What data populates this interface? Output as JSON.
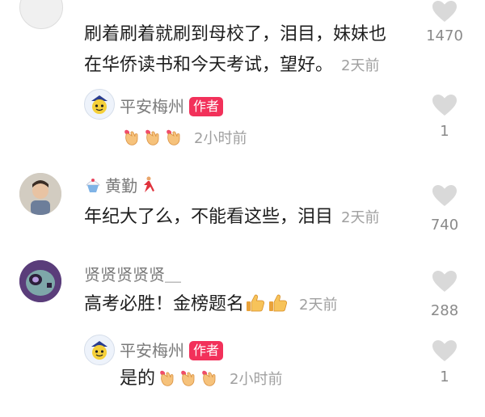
{
  "comments": [
    {
      "username": "",
      "text_line1": "刷着刷着就刷到母校了，泪目，妹妹也",
      "text_line2": "在华侨读书和今天考试，望好。",
      "time": "2天前",
      "likes": "1470"
    },
    {
      "username": "平安梅州",
      "author_tag": "作者",
      "time": "2小时前",
      "likes": "1"
    },
    {
      "username": "黄勤",
      "text": "年纪大了么，不能看这些，泪目",
      "time": "2天前",
      "likes": "740"
    },
    {
      "username": "贤贤贤贤贤＿",
      "text": "高考必胜！金榜题名",
      "time": "2天前",
      "likes": "288"
    },
    {
      "username": "平安梅州",
      "author_tag": "作者",
      "text": "是的",
      "time": "2小时前",
      "likes": "1"
    }
  ],
  "icons": {
    "like": "heart-icon",
    "finger_heart": "finger-heart-emoji",
    "thumbs_up": "thumbs-up-emoji",
    "shaved_ice": "shaved-ice-emoji",
    "dancer": "dancer-emoji"
  },
  "colors": {
    "author_tag": "#f2315a",
    "heart": "#d9d9d9",
    "time": "#a0a0a0",
    "username": "#7a7a7a"
  }
}
